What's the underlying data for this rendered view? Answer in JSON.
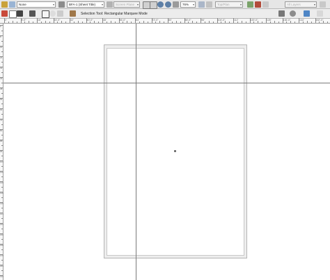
{
  "toolbar_top": {
    "class_select": "None",
    "view_select": "BFA-1 (Sheet Title)",
    "plane_select": "Screen Plane",
    "zoom_value": "76%",
    "render_select": "Top/Plan",
    "layers_select": "All Layers"
  },
  "toolbar_mode": {
    "status_text": "Selection Tool: Rectangular Marquee Mode"
  },
  "ruler": {
    "h_labels": [
      "0'",
      "8'-0\"",
      "16'",
      "24'-0\"",
      "32'",
      "40'-0\"",
      "48'",
      "56'-0\"",
      "64'",
      "72'-0\"",
      "80'",
      "88'-0\"",
      "96'",
      "104'-0\"",
      "112'",
      "120'-0\"",
      "128'",
      "136'-0\"",
      "144'",
      "152'-0\""
    ],
    "v_labels": [
      "0",
      "8",
      "16",
      "24",
      "32",
      "40",
      "48",
      "56",
      "64",
      "72",
      "80",
      "88",
      "96",
      "104",
      "112",
      "120",
      "128",
      "136",
      "144",
      "152",
      "160",
      "168",
      "176",
      "184",
      "192"
    ]
  },
  "colors": {
    "toolbar_bg": "#e6e6e6",
    "guide": "#7a7a7a",
    "sheet_border": "#b5b5b5"
  },
  "icons": [
    "pencil-icon",
    "dual-pencil-icon",
    "pan-hand-icon",
    "eyedropper-icon",
    "gear-icon",
    "paint-bucket-icon",
    "chevron-down-icon",
    "zoom-in-icon",
    "zoom-out-icon",
    "rectangle-marquee-icon",
    "lasso-icon",
    "polygon-marquee-icon",
    "selection-tool-icon",
    "page-icon",
    "layers-icon"
  ]
}
